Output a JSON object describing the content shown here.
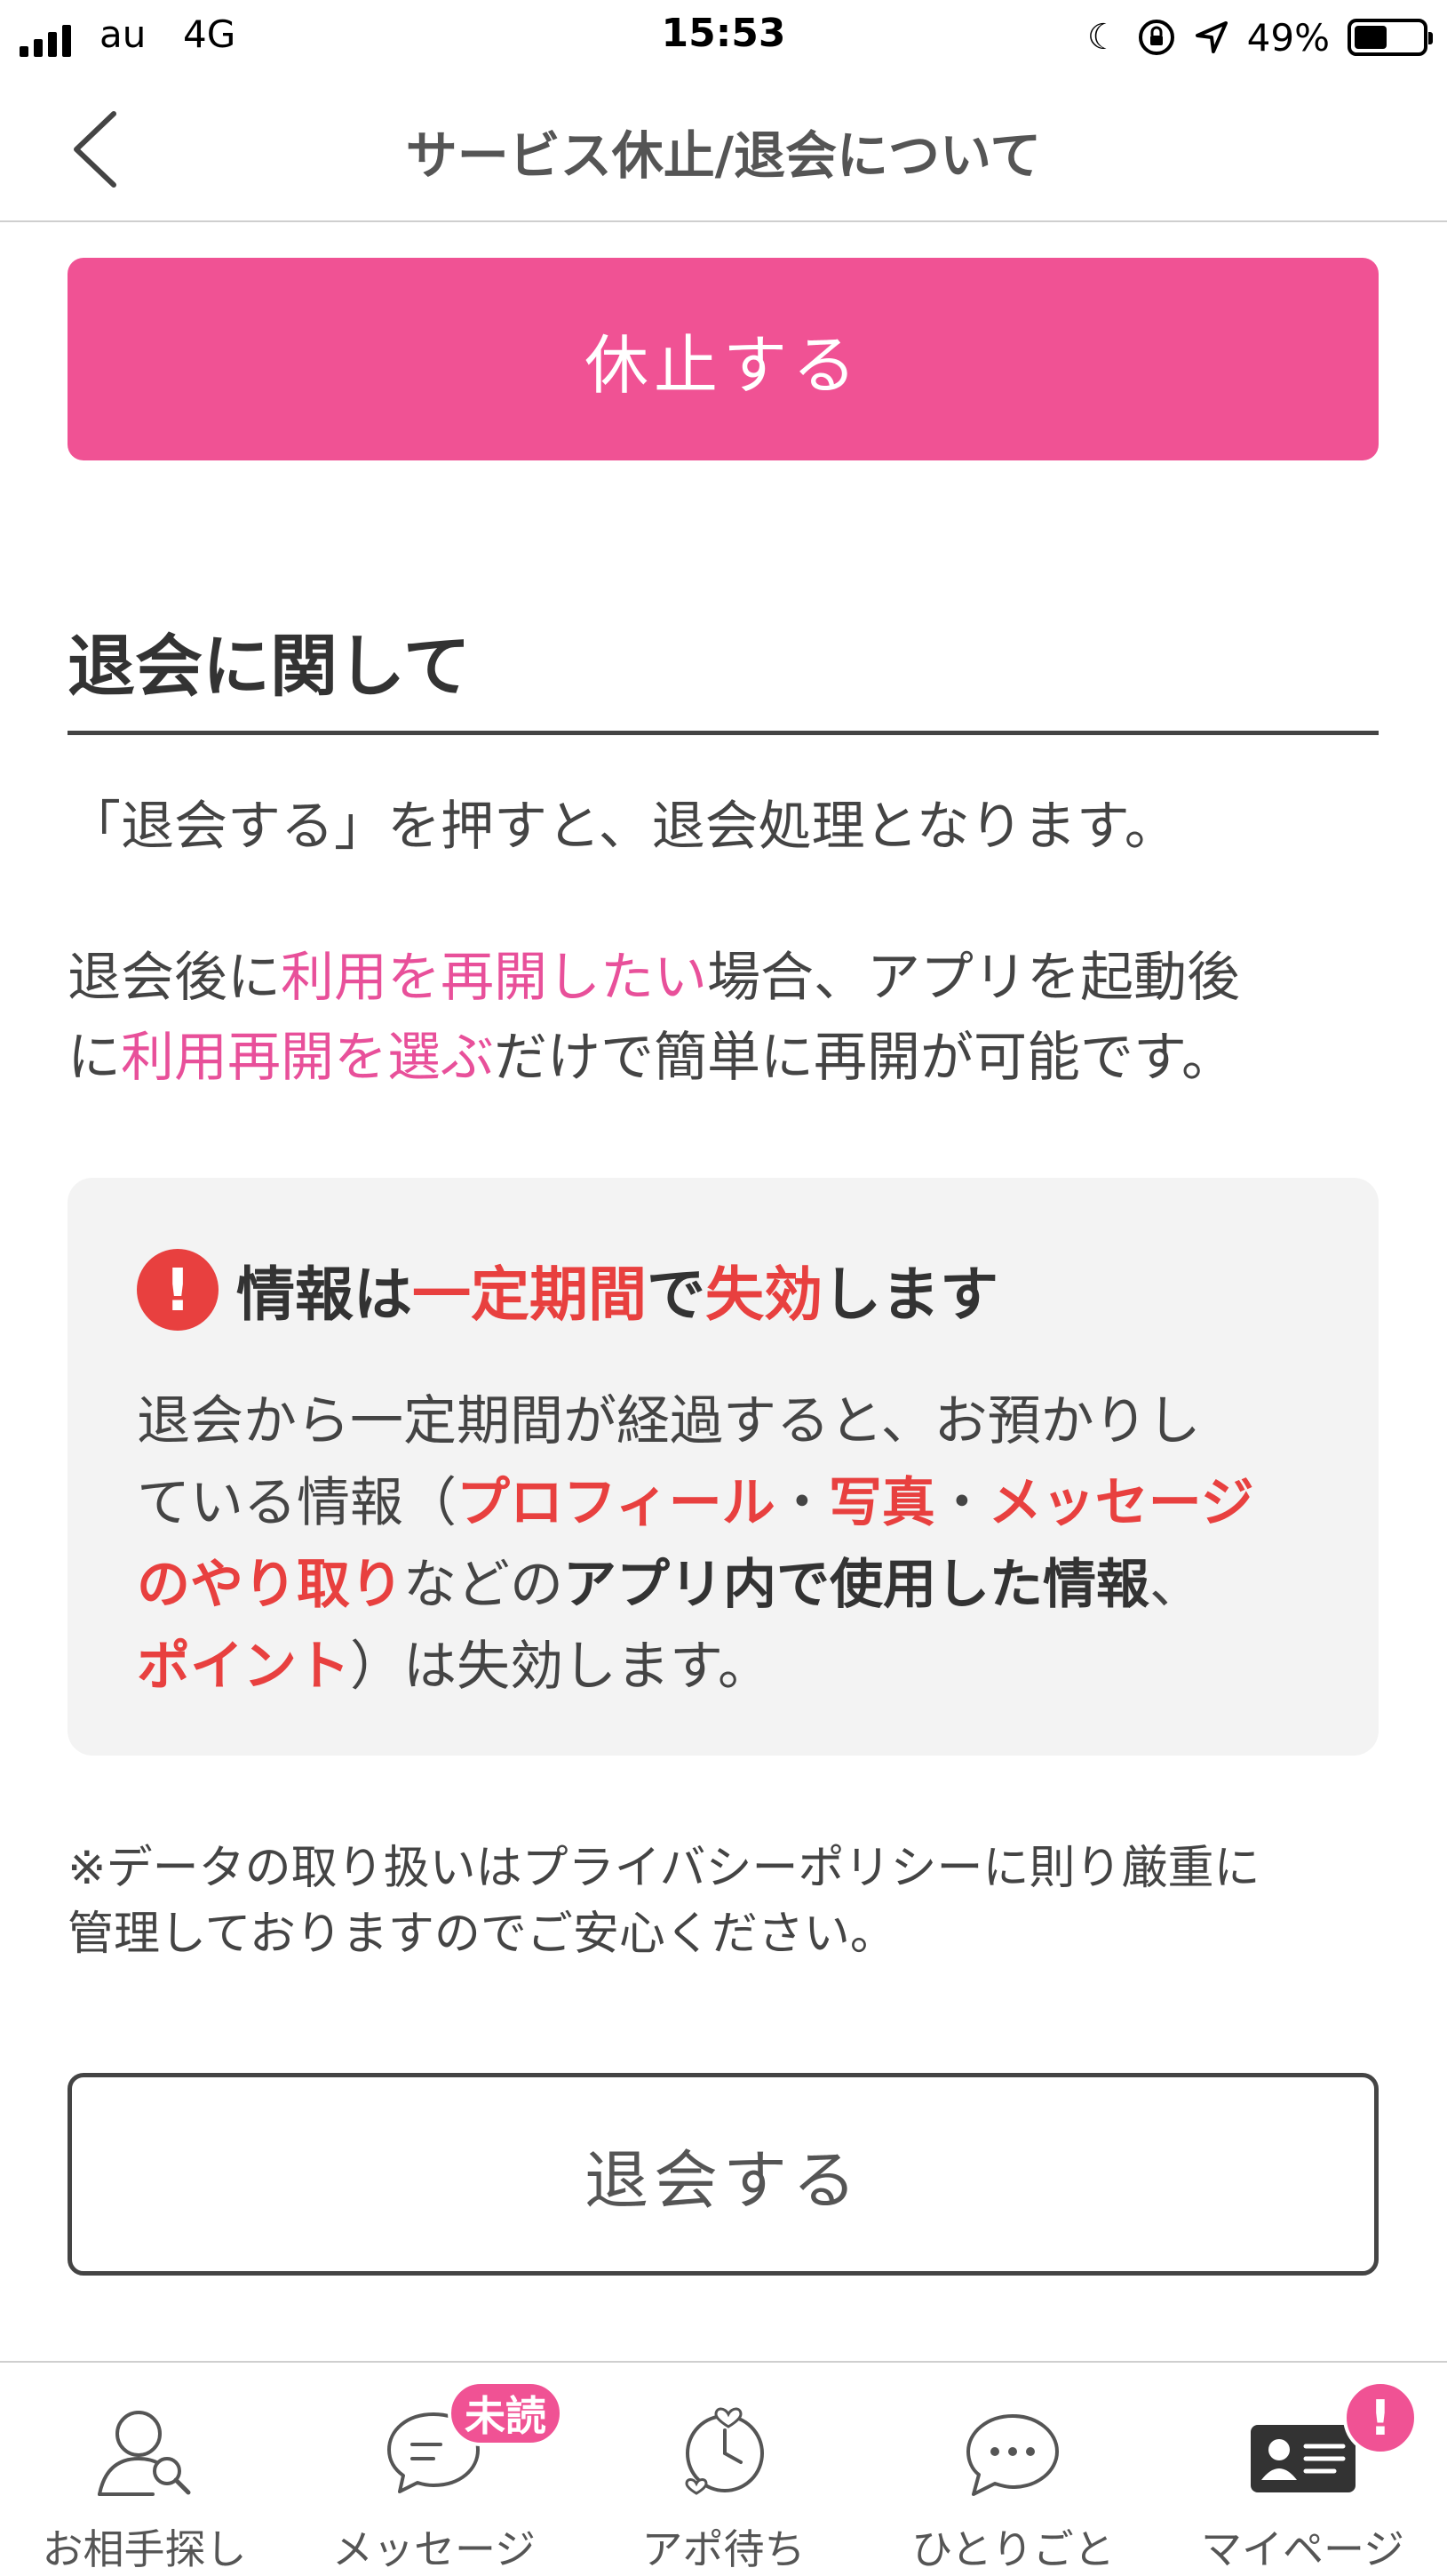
{
  "status_bar": {
    "carrier": "au",
    "network": "4G",
    "time": "15:53",
    "battery": "49%",
    "battery_level": 0.49
  },
  "nav": {
    "title": "サービス休止/退会について",
    "back_icon": "chevron-left-icon"
  },
  "pause_button": {
    "label": "休止する",
    "color": "#f05294"
  },
  "withdraw_section": {
    "heading": "退会に関して",
    "para1": "「退会する」を押すと、退会処理となります。",
    "para2": {
      "t1": "退会後に",
      "h1": "利用を再開したい",
      "t2": "場合、アプリを起動後",
      "t3": "に",
      "h2": "利用再開を選ぶ",
      "t4": "だけで簡単に再開が可能です。"
    }
  },
  "info_box": {
    "icon": "exclamation-icon",
    "title": {
      "t1": "情報は",
      "h1": "一定期間",
      "t2": "で",
      "h2": "失効",
      "t3": "します"
    },
    "body": {
      "line1": "退会から一定期間が経過すると、お預かりし",
      "t2": "ている情報（",
      "h1": "プロフィール",
      "sep1": "・",
      "h2": "写真",
      "sep2": "・",
      "h3": "メッセージ",
      "h4": "のやり取り",
      "t3": "などの",
      "b1": "アプリ内で使用した情報",
      "t4": "、",
      "h5": "ポイント",
      "t5": "）は失効します。"
    }
  },
  "note": {
    "line1": "※データの取り扱いはプライバシーポリシーに則り厳重に",
    "line2": "管理しておりますのでご安心ください。"
  },
  "withdraw_button": {
    "label": "退会する"
  },
  "tab_bar": {
    "items": [
      {
        "label": "お相手探し",
        "icon": "search-person-icon"
      },
      {
        "label": "メッセージ",
        "icon": "chat-bubble-icon",
        "badge": "未読"
      },
      {
        "label": "アポ待ち",
        "icon": "clock-heart-icon"
      },
      {
        "label": "ひとりごと",
        "icon": "speech-dots-icon"
      },
      {
        "label": "マイページ",
        "icon": "id-card-icon",
        "badge": "!"
      }
    ]
  },
  "colors": {
    "accent_pink": "#f05294",
    "highlight_pink": "#e8509a",
    "alert_red": "#e8403f"
  }
}
